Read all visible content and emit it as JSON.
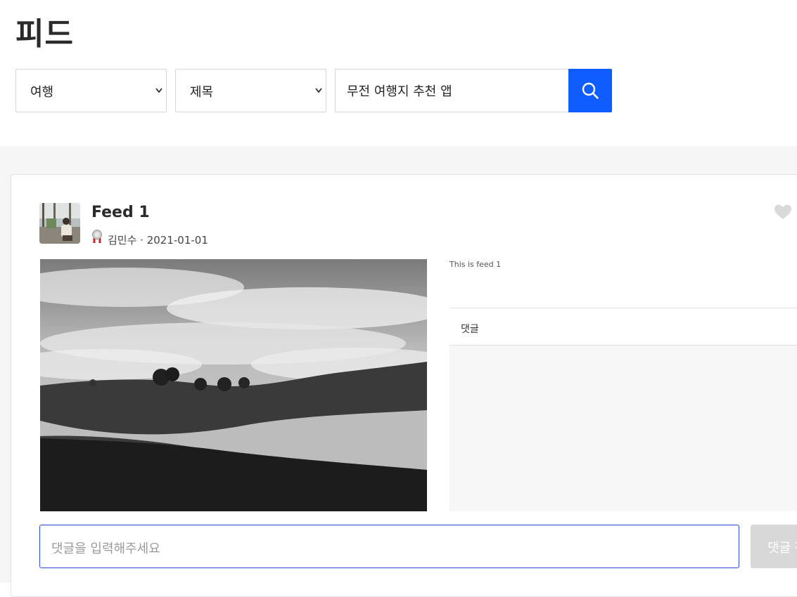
{
  "page": {
    "title": "피드"
  },
  "filters": {
    "category": {
      "selected": "여행"
    },
    "search_field": {
      "selected": "제목"
    },
    "search": {
      "value": "무전 여행지 추천 앱"
    }
  },
  "feed": {
    "title": "Feed 1",
    "author": "김민수",
    "date": "2021-01-01",
    "author_line": "김민수 · 2021-01-01",
    "description": "This is feed 1",
    "liked": false
  },
  "comments": {
    "header": "댓글",
    "input_placeholder": "댓글을 입력해주세요",
    "submit_label": "댓글 작성"
  },
  "icons": {
    "search": "search-icon",
    "heart": "heart-icon",
    "chevron": "chevron-down-icon",
    "badge": "medal-icon"
  },
  "colors": {
    "accent": "#0f5cff",
    "input_focus_border": "#2b48d6",
    "heart": "#d9d9d9",
    "disabled_button": "#d8d8d8"
  }
}
